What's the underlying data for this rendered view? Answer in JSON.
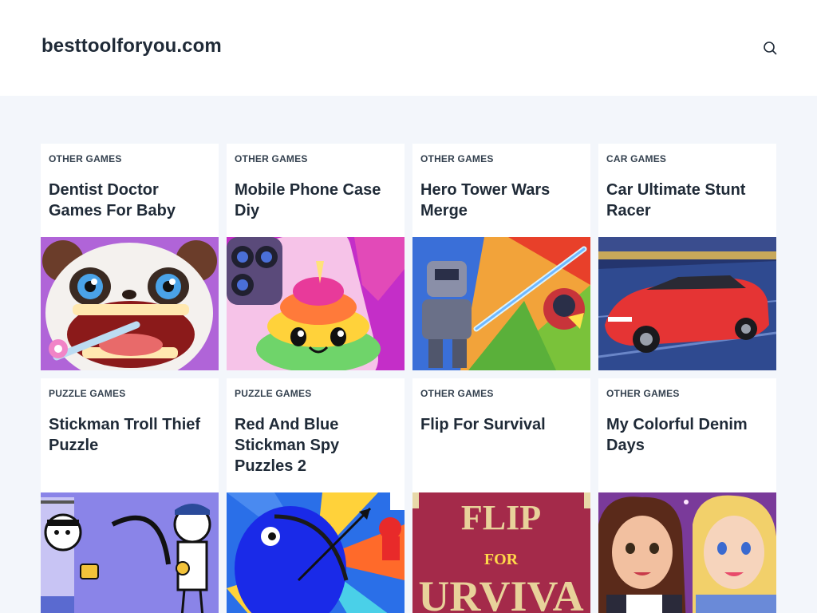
{
  "header": {
    "site_title": "besttoolforyou.com",
    "search_icon": "search-icon"
  },
  "cards": [
    {
      "category": "OTHER GAMES",
      "title": "Dentist Doctor Games For Baby"
    },
    {
      "category": "OTHER GAMES",
      "title": "Mobile Phone Case Diy"
    },
    {
      "category": "OTHER GAMES",
      "title": "Hero Tower Wars Merge"
    },
    {
      "category": "CAR GAMES",
      "title": "Car Ultimate Stunt Racer"
    },
    {
      "category": "PUZZLE GAMES",
      "title": "Stickman Troll Thief Puzzle"
    },
    {
      "category": "PUZZLE GAMES",
      "title": "Red And Blue Stickman Spy Puzzles 2"
    },
    {
      "category": "OTHER GAMES",
      "title": "Flip For Survival"
    },
    {
      "category": "OTHER GAMES",
      "title": "My Colorful Denim Days"
    }
  ],
  "thumbnail_text": {
    "flip_line1": "FLIP",
    "flip_line2": "FOR",
    "flip_line3": "URVIVA"
  },
  "colors": {
    "page_bg": "#f3f6fb",
    "card_bg": "#ffffff",
    "text": "#1f2a37"
  }
}
